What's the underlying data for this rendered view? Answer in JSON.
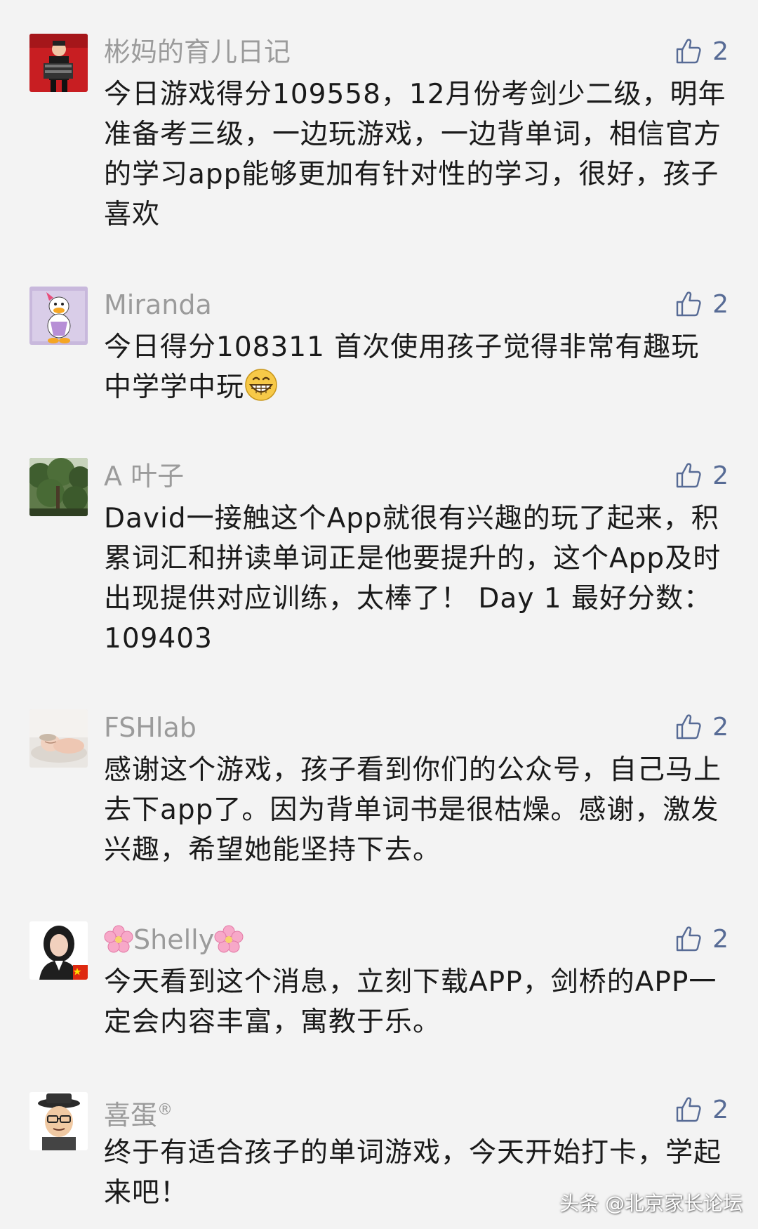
{
  "comments": [
    {
      "name": "彬妈的育儿日记",
      "likes": "2",
      "text": "今日游戏得分109558，12月份考剑少二级，明年准备考三级，一边玩游戏，一边背单词，相信官方的学习app能够更加有针对性的学习，很好，孩子喜欢",
      "avatar_icon": "user-avatar-boy-accordion"
    },
    {
      "name": "Miranda",
      "likes": "2",
      "text": "今日得分108311 首次使用孩子觉得非常有趣玩中学学中玩",
      "emoji": "grinning-face-icon",
      "avatar_icon": "user-avatar-cartoon-duck"
    },
    {
      "name": "A 叶子",
      "likes": "2",
      "text": "David一接触这个App就很有兴趣的玩了起来，积累词汇和拼读单词正是他要提升的，这个App及时出现提供对应训练，太棒了！ Day 1 最好分数：109403",
      "avatar_icon": "user-avatar-trees"
    },
    {
      "name": "FSHlab",
      "likes": "2",
      "text": "感谢这个游戏，孩子看到你们的公众号，自己马上去下app了。因为背单词书是很枯燥。感谢，激发兴趣，希望她能坚持下去。",
      "avatar_icon": "user-avatar-baby"
    },
    {
      "name": "Shelly",
      "likes": "2",
      "text": "今天看到这个消息，立刻下载APP，剑桥的APP一定会内容丰富，寓教于乐。",
      "avatar_icon": "user-avatar-woman"
    },
    {
      "name": "喜蛋",
      "name_suffix": "®",
      "likes": "2",
      "text": "终于有适合孩子的单词游戏，今天开始打卡，学起来吧！",
      "avatar_icon": "user-avatar-3d-man-hat"
    }
  ],
  "watermark": "头条 @北京家长论坛",
  "like_icon": "thumbs-up-icon",
  "colors": {
    "background": "#f3f3f3",
    "name": "#9b9b9b",
    "text": "#1a1a1a",
    "like": "#576b95"
  }
}
